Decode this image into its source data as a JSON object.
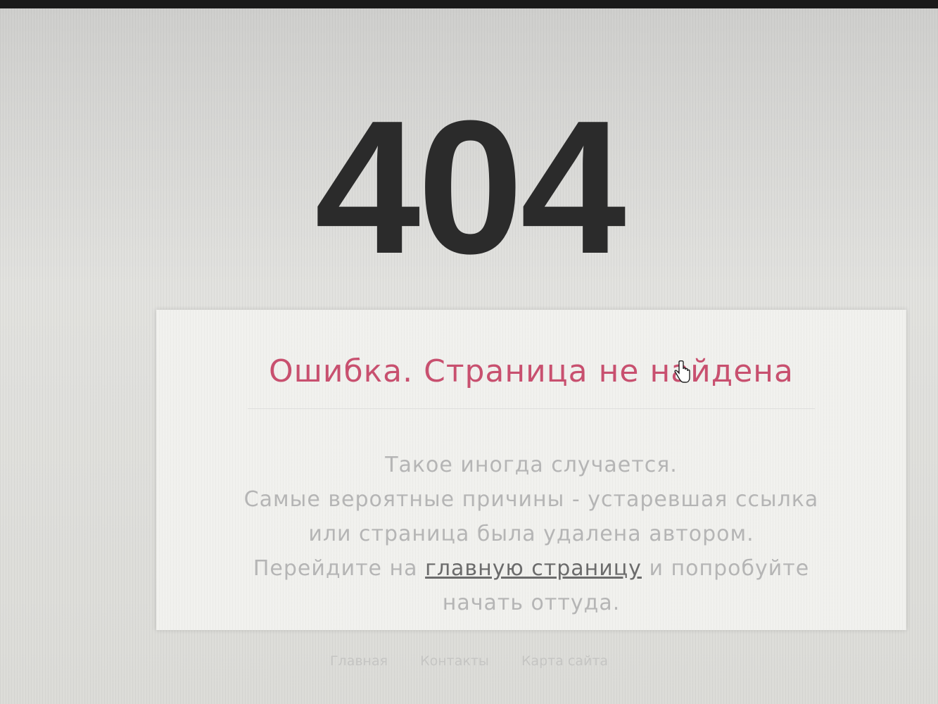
{
  "error": {
    "code": "404",
    "title": "Ошибка. Страница не найдена",
    "message": {
      "line1": "Такое иногда случается.",
      "line2": "Самые вероятные причины - устаревшая ссылка",
      "line3": "или страница была удалена автором.",
      "line4_before": "Перейдите на ",
      "home_link": "главную страницу",
      "line4_after": " и попробуйте",
      "line5": "начать оттуда."
    }
  },
  "footer": {
    "links": [
      "Главная",
      "Контакты",
      "Карта сайта"
    ]
  },
  "colors": {
    "title": "#c8506f",
    "code": "#2b2b2b",
    "message": "#b5b5b5"
  },
  "icons": {
    "cursor": "hand-pointer-icon"
  }
}
